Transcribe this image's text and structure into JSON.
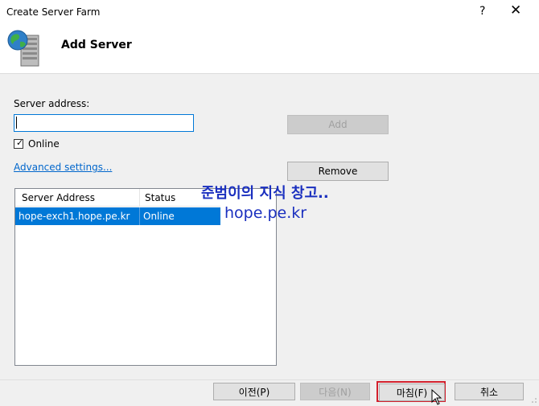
{
  "window": {
    "title": "Create Server Farm",
    "help_label": "?",
    "close_label": "✕"
  },
  "header": {
    "title": "Add Server",
    "icon": "server-globe-icon"
  },
  "form": {
    "server_address_label": "Server address:",
    "server_address_value": "",
    "online_label": "Online",
    "online_checked": true,
    "advanced_link": "Advanced settings...",
    "add_button": "Add",
    "remove_button": "Remove"
  },
  "list": {
    "columns": [
      "Server Address",
      "Status"
    ],
    "rows": [
      {
        "address": "hope-exch1.hope.pe.kr",
        "status": "Online",
        "selected": true
      }
    ]
  },
  "watermark": {
    "line1": "준범이의 지식 창고..",
    "line2": "hope.pe.kr"
  },
  "footer": {
    "prev_button": "이전(P)",
    "next_button": "다음(N)",
    "finish_button": "마침(F)",
    "cancel_button": "취소"
  },
  "colors": {
    "accent": "#0078d7",
    "highlight_border": "#d3202d",
    "watermark": "#1a2fbf",
    "link": "#0066cc"
  }
}
